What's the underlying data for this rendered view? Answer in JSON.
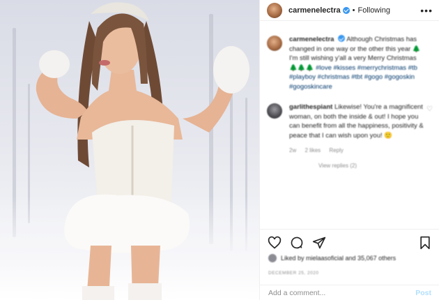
{
  "post": {
    "username": "carmenelectra",
    "separator": "•",
    "follow_state": "Following",
    "more_icon": "more-options-icon"
  },
  "caption": {
    "username": "carmenelectra",
    "text": "Although Christmas has changed in one way or the other this year 🌲 I'm still wishing y'all a very Merry Christmas 🌲🌲🌲",
    "tags": "#love #kisses #merrychristmas #tb #playboy #christmas #tbt #gogo #gogoskin #gogoskincare"
  },
  "comment": {
    "username": "garlithespiant",
    "text": "Likewise! You're a magnificent woman, on both the inside & out! I hope you can benefit from all the happiness, positivity & peace that I can wish upon you! 🙂",
    "age": "2w",
    "likes": "2 likes",
    "reply_label": "Reply",
    "view_replies": "View replies (2)"
  },
  "actions": {
    "icons": [
      "heart-icon",
      "comment-icon",
      "share-icon",
      "bookmark-icon"
    ]
  },
  "likes_line": "Liked by mielaasoficial and 35,067 others",
  "date": "DECEMBER 25, 2020",
  "add_comment": {
    "placeholder": "Add a comment...",
    "post_label": "Post"
  },
  "colors": {
    "link": "#00376b",
    "verified": "#3897f0",
    "post_disabled": "#b2dffc",
    "muted": "#8e8e8e"
  }
}
